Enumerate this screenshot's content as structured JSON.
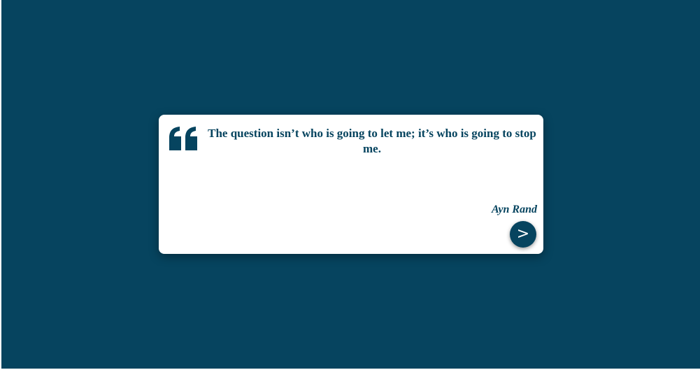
{
  "quote": {
    "text": "The question isn’t who is going to let me; it’s who is going to stop me.",
    "author": "Ayn Rand",
    "icon": "quote-icon"
  },
  "controls": {
    "next_label": ">"
  },
  "colors": {
    "background": "#06445f",
    "card": "#ffffff",
    "accent": "#06445f"
  }
}
